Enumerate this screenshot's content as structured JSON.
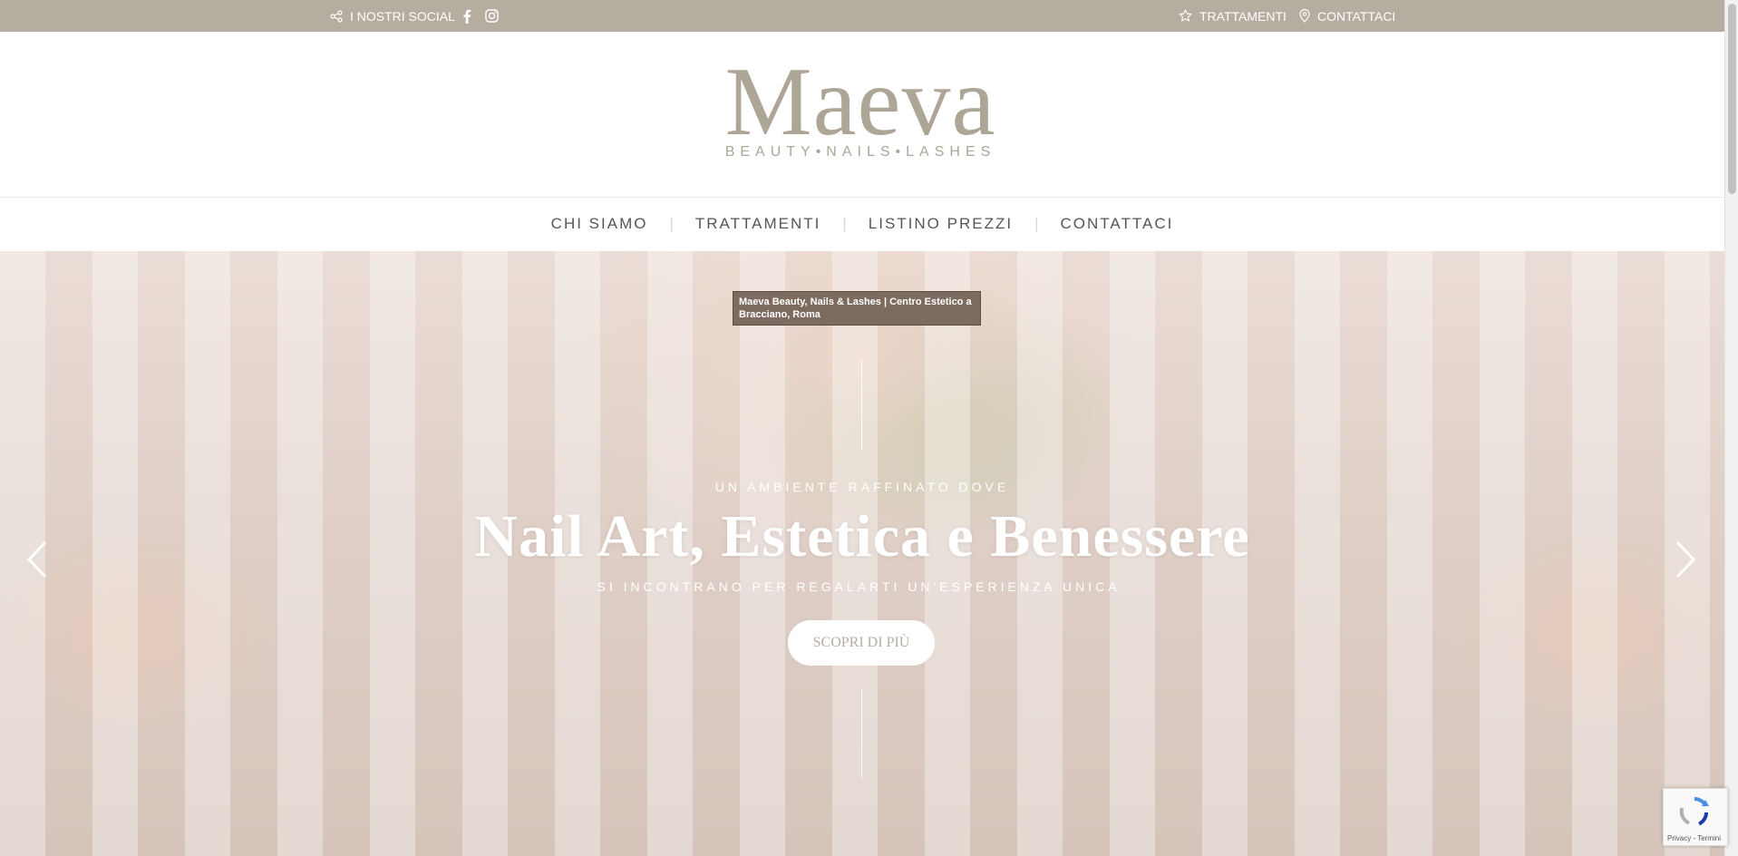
{
  "topbar": {
    "social_label": "I NOSTRI SOCIAL",
    "links": [
      "TRATTAMENTI",
      "CONTATTACI"
    ],
    "icons": [
      "share-icon",
      "facebook-icon",
      "instagram-icon",
      "star-icon",
      "map-pin-icon"
    ]
  },
  "logo": {
    "name": "Maeva",
    "tagline": "BEAUTY•NAILS•LASHES"
  },
  "nav": {
    "items": [
      "CHI SIAMO",
      "TRATTAMENTI",
      "LISTINO PREZZI",
      "CONTATTACI"
    ],
    "separator": "|"
  },
  "hero": {
    "tooltip": "Maeva Beauty, Nails & Lashes | Centro Estetico a Bracciano, Roma",
    "eyebrow": "UN AMBIENTE RAFFINATO DOVE",
    "headline": "Nail Art, Estetica e Benessere",
    "subline": "SI INCONTRANO PER REGALARTI UN'ESPERIENZA UNICA.",
    "cta": "SCOPRI DI PIÙ",
    "arrows": [
      "chevron-left-icon",
      "chevron-right-icon"
    ]
  },
  "recaptcha": {
    "text": "Privacy - Termini"
  },
  "colors": {
    "topbar_bg": "#b5ada0",
    "logo": "#ada697",
    "nav_text": "#555555",
    "cta_text": "#b5ada0"
  }
}
